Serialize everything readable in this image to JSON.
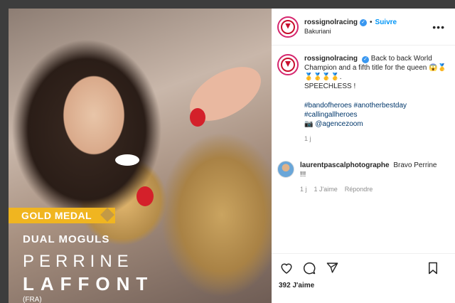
{
  "post": {
    "media": {
      "banner": "GOLD MEDAL",
      "event": "DUAL MOGULS",
      "first_name": "PERRINE",
      "last_name": "LAFFONT",
      "country": "(FRA)",
      "accent_color": "#f0b520"
    },
    "header": {
      "username": "rossignolracing",
      "follow_label": "Suivre",
      "location": "Bakuriani",
      "separator": "•"
    },
    "caption": {
      "username": "rossignolracing",
      "text": "Back to back World Champion and a fifth title for the queen",
      "emojis": "😱🥇🥇🥇🥇🥇.",
      "exclaim": "SPEECHLESS !",
      "hashtags_line1": "#bandofheroes #anotherbestday",
      "hashtags_line2": "#callingallheroes",
      "credit": "📷 @agencezoom",
      "time": "1 j"
    },
    "comment": {
      "username": "laurentpascalphotographe",
      "text": "Bravo Perrine !!!",
      "time": "1 j",
      "likes": "1 J'aime",
      "reply_label": "Répondre"
    },
    "actions": {
      "like_icon": "heart-icon",
      "comment_icon": "comment-icon",
      "share_icon": "share-icon",
      "save_icon": "bookmark-icon"
    },
    "likes_label": "392 J'aime"
  }
}
